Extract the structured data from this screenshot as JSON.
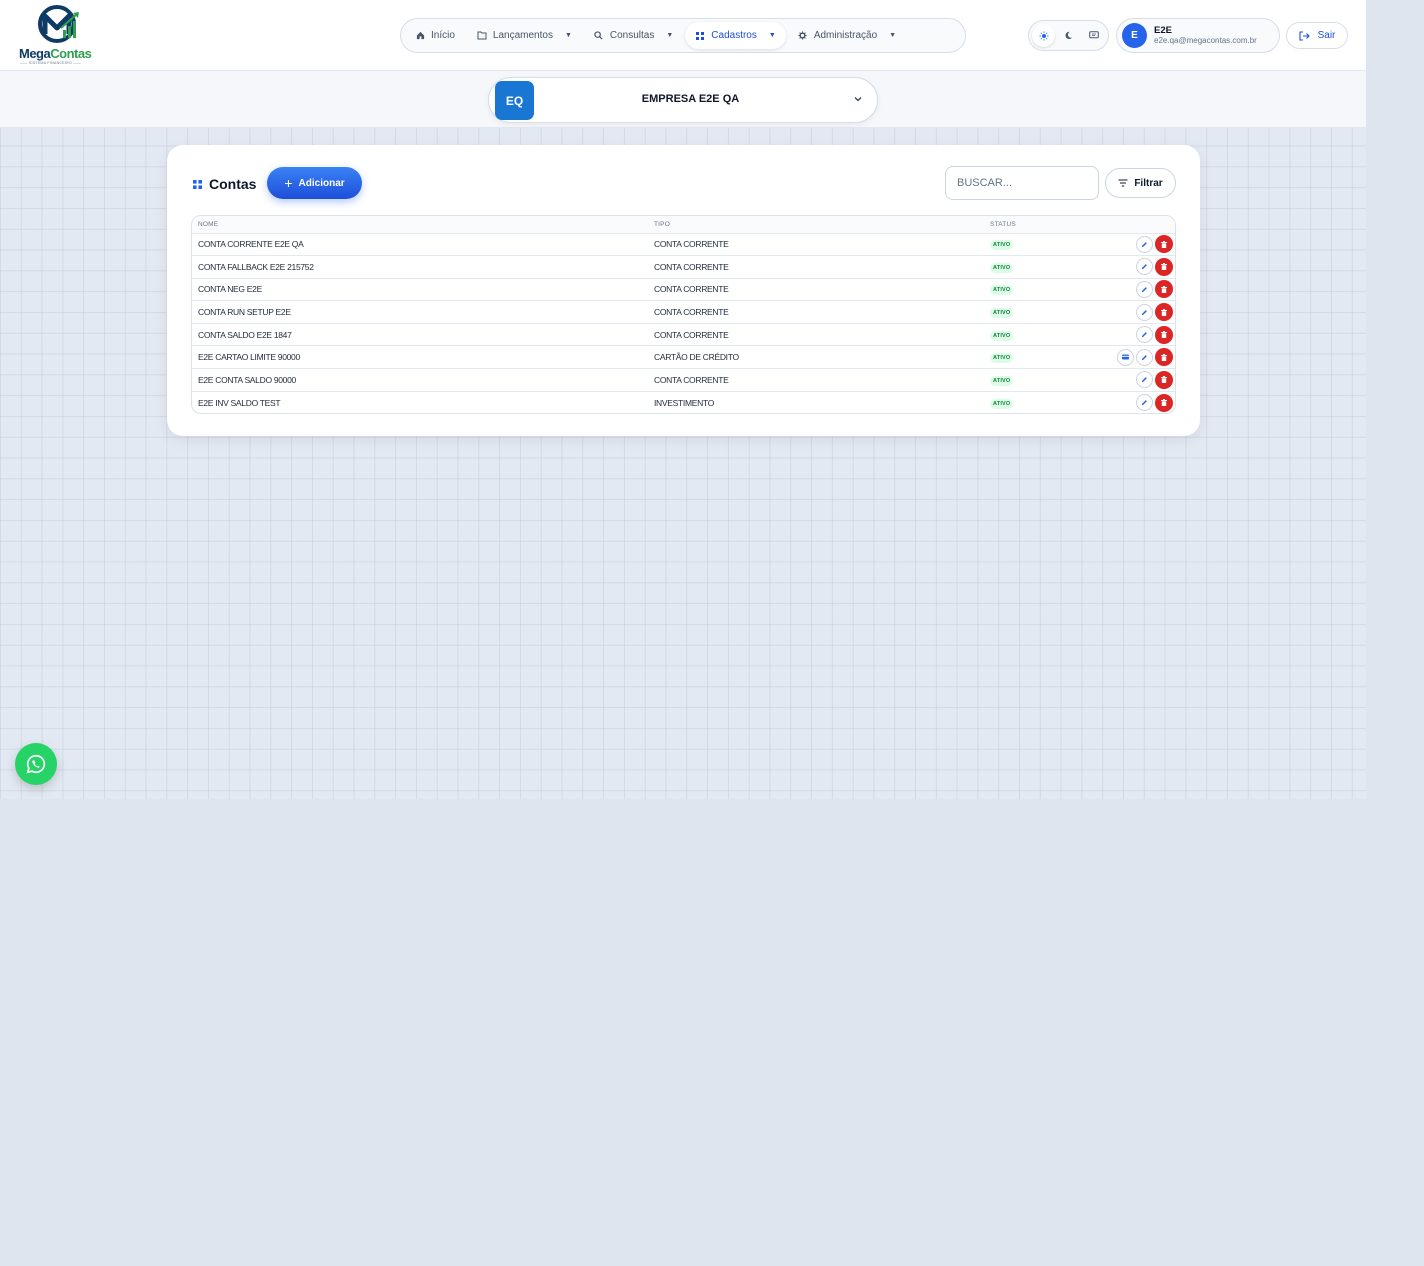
{
  "brand": {
    "name_part1": "Mega",
    "name_part2": "Contas",
    "subtitle": "SISTEMA FINANCEIRO",
    "logo_letter": "M"
  },
  "nav": {
    "items": [
      {
        "label": "Início",
        "icon": "home-icon",
        "has_caret": false,
        "active": false
      },
      {
        "label": "Lançamentos",
        "icon": "folder-icon",
        "has_caret": true,
        "active": false
      },
      {
        "label": "Consultas",
        "icon": "search-icon",
        "has_caret": true,
        "active": false
      },
      {
        "label": "Cadastros",
        "icon": "grid-icon",
        "has_caret": true,
        "active": true
      },
      {
        "label": "Administração",
        "icon": "gear-icon",
        "has_caret": true,
        "active": false
      }
    ]
  },
  "theme": {
    "options": [
      "sun-icon",
      "moon-icon",
      "monitor-icon"
    ],
    "selected": "sun-icon"
  },
  "user": {
    "initial": "E",
    "name": "E2E",
    "email": "e2e.qa@megacontas.com.br"
  },
  "logout_label": "Sair",
  "company": {
    "badge": "EQ",
    "name": "EMPRESA E2E QA"
  },
  "card": {
    "title": "Contas",
    "add_label": "Adicionar",
    "search_placeholder": "BUSCAR...",
    "filter_label": "Filtrar"
  },
  "table": {
    "columns": [
      "NOME",
      "TIPO",
      "STATUS"
    ],
    "rows": [
      {
        "nome": "CONTA CORRENTE E2E QA",
        "tipo": "CONTA CORRENTE",
        "status": "ATIVO",
        "extra_action": false
      },
      {
        "nome": "CONTA FALLBACK E2E 215752",
        "tipo": "CONTA CORRENTE",
        "status": "ATIVO",
        "extra_action": false
      },
      {
        "nome": "CONTA NEG E2E",
        "tipo": "CONTA CORRENTE",
        "status": "ATIVO",
        "extra_action": false
      },
      {
        "nome": "CONTA RUN SETUP E2E",
        "tipo": "CONTA CORRENTE",
        "status": "ATIVO",
        "extra_action": false
      },
      {
        "nome": "CONTA SALDO E2E 1847",
        "tipo": "CONTA CORRENTE",
        "status": "ATIVO",
        "extra_action": false
      },
      {
        "nome": "E2E CARTAO LIMITE 90000",
        "tipo": "CARTÃO DE CRÉDITO",
        "status": "ATIVO",
        "extra_action": true
      },
      {
        "nome": "E2E CONTA SALDO 90000",
        "tipo": "CONTA CORRENTE",
        "status": "ATIVO",
        "extra_action": false
      },
      {
        "nome": "E2E INV SALDO TEST",
        "tipo": "INVESTIMENTO",
        "status": "ATIVO",
        "extra_action": false
      }
    ]
  },
  "colors": {
    "primary": "#2563eb",
    "danger": "#dc2626",
    "success": "#15803d",
    "whatsapp": "#25d366"
  }
}
